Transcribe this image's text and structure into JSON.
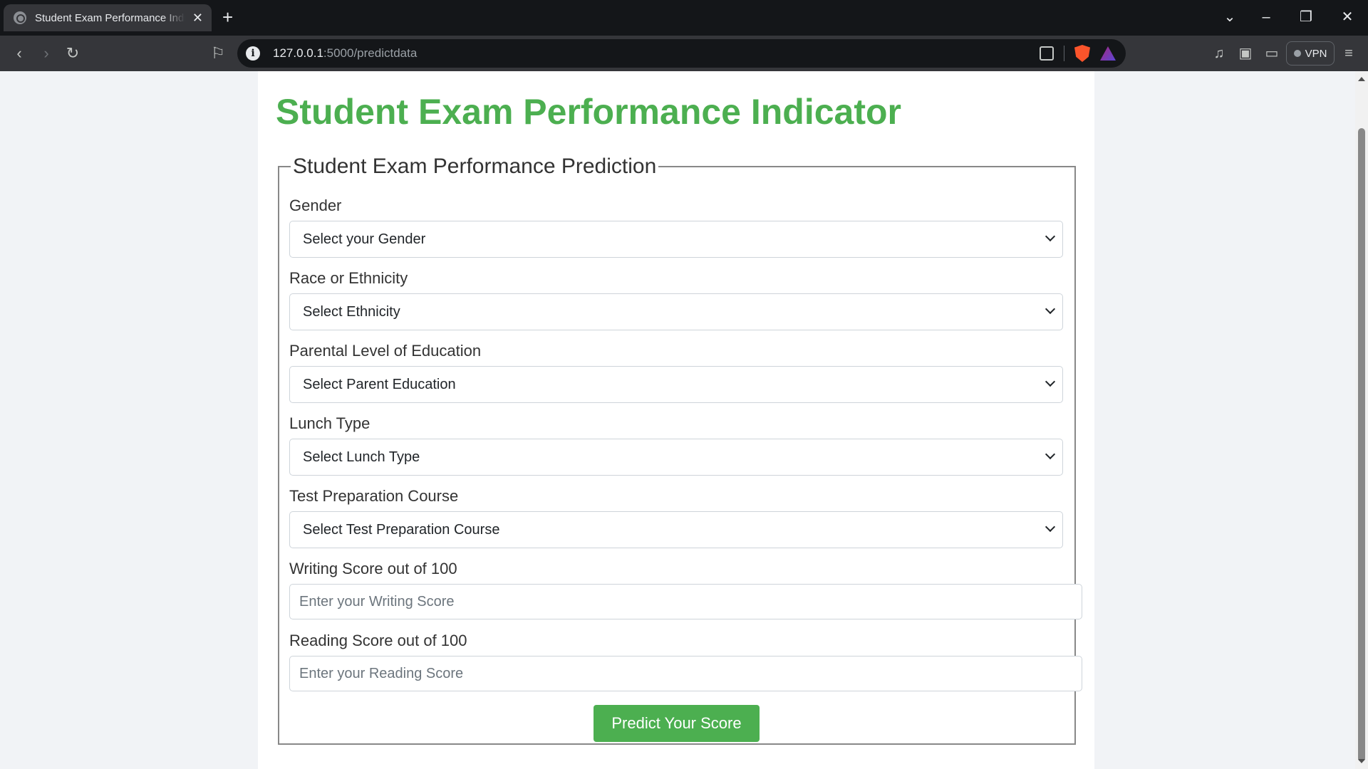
{
  "browser": {
    "tab_title": "Student Exam Performance Indicator",
    "url_host": "127.0.0.1",
    "url_path": ":5000/predictdata",
    "vpn_label": "VPN"
  },
  "page": {
    "heading": "Student Exam Performance Indicator",
    "legend": "Student Exam Performance Prediction",
    "fields": {
      "gender": {
        "label": "Gender",
        "selected": "Select your Gender"
      },
      "ethnicity": {
        "label": "Race or Ethnicity",
        "selected": "Select Ethnicity"
      },
      "parent_education": {
        "label": "Parental Level of Education",
        "selected": "Select Parent Education"
      },
      "lunch": {
        "label": "Lunch Type",
        "selected": "Select Lunch Type"
      },
      "test_prep": {
        "label": "Test Preparation Course",
        "selected": "Select Test Preparation Course"
      },
      "writing": {
        "label": "Writing Score out of 100",
        "placeholder": "Enter your Writing Score"
      },
      "reading": {
        "label": "Reading Score out of 100",
        "placeholder": "Enter your Reading Score"
      }
    },
    "submit_label": "Predict Your Score"
  },
  "colors": {
    "accent": "#4caf50",
    "chrome_dark": "#141619",
    "chrome_toolbar": "#35363a"
  }
}
